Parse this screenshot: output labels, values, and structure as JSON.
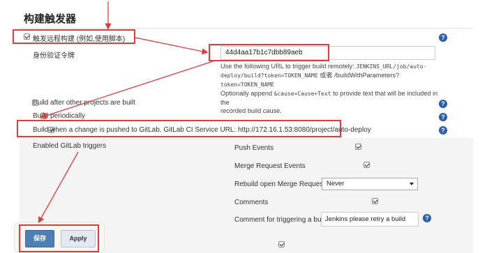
{
  "section": {
    "title": "构建触发器"
  },
  "trigger_remote": {
    "label": "触发远程构建 (例如,使用脚本)",
    "checked": true
  },
  "auth_token": {
    "label": "身份验证令牌",
    "value": "44d4aa17b1c7dbb89aeb",
    "help_line1_a": "Use the following URL to trigger build remotely: ",
    "help_line1_b": "JENKINS_URL/job/auto-",
    "help_line2_a": "deploy/build?token=TOKEN_NAME",
    "help_line2_b": " 或者 /buildWithParameters?",
    "help_line2_c": "token=TOKEN_NAME",
    "help_line3_a": "Optionally append ",
    "help_line3_b": "&cause=Cause+Text",
    "help_line3_c": " to provide text that will be included in the",
    "help_line4": "recorded build cause."
  },
  "build_after_other": {
    "label": "Build after other projects are built",
    "checked": false
  },
  "build_periodically": {
    "label": "Build periodically",
    "checked": false
  },
  "gitlab_push": {
    "label": "Build when a change is pushed to GitLab. GitLab CI Service URL: http://172.16.1.53:8080/project/auto-deploy",
    "checked": true
  },
  "gitlab_triggers": {
    "heading": "Enabled GitLab triggers",
    "push_events": {
      "label": "Push Events",
      "checked": true
    },
    "merge_request_events": {
      "label": "Merge Request Events",
      "checked": true
    },
    "rebuild_open_mr": {
      "label": "Rebuild open Merge Requests",
      "selected": "Never"
    },
    "comments": {
      "label": "Comments",
      "checked": true
    },
    "comment_trigger": {
      "label": "Comment for triggering a build",
      "value": "Jenkins please retry a build"
    }
  },
  "buttons": {
    "save": "保存",
    "apply": "Apply"
  },
  "help_icon": {
    "glyph": "?",
    "icon": "question-circle-icon",
    "color": "#2a5db0"
  },
  "annotation_color": "#e23b3b"
}
